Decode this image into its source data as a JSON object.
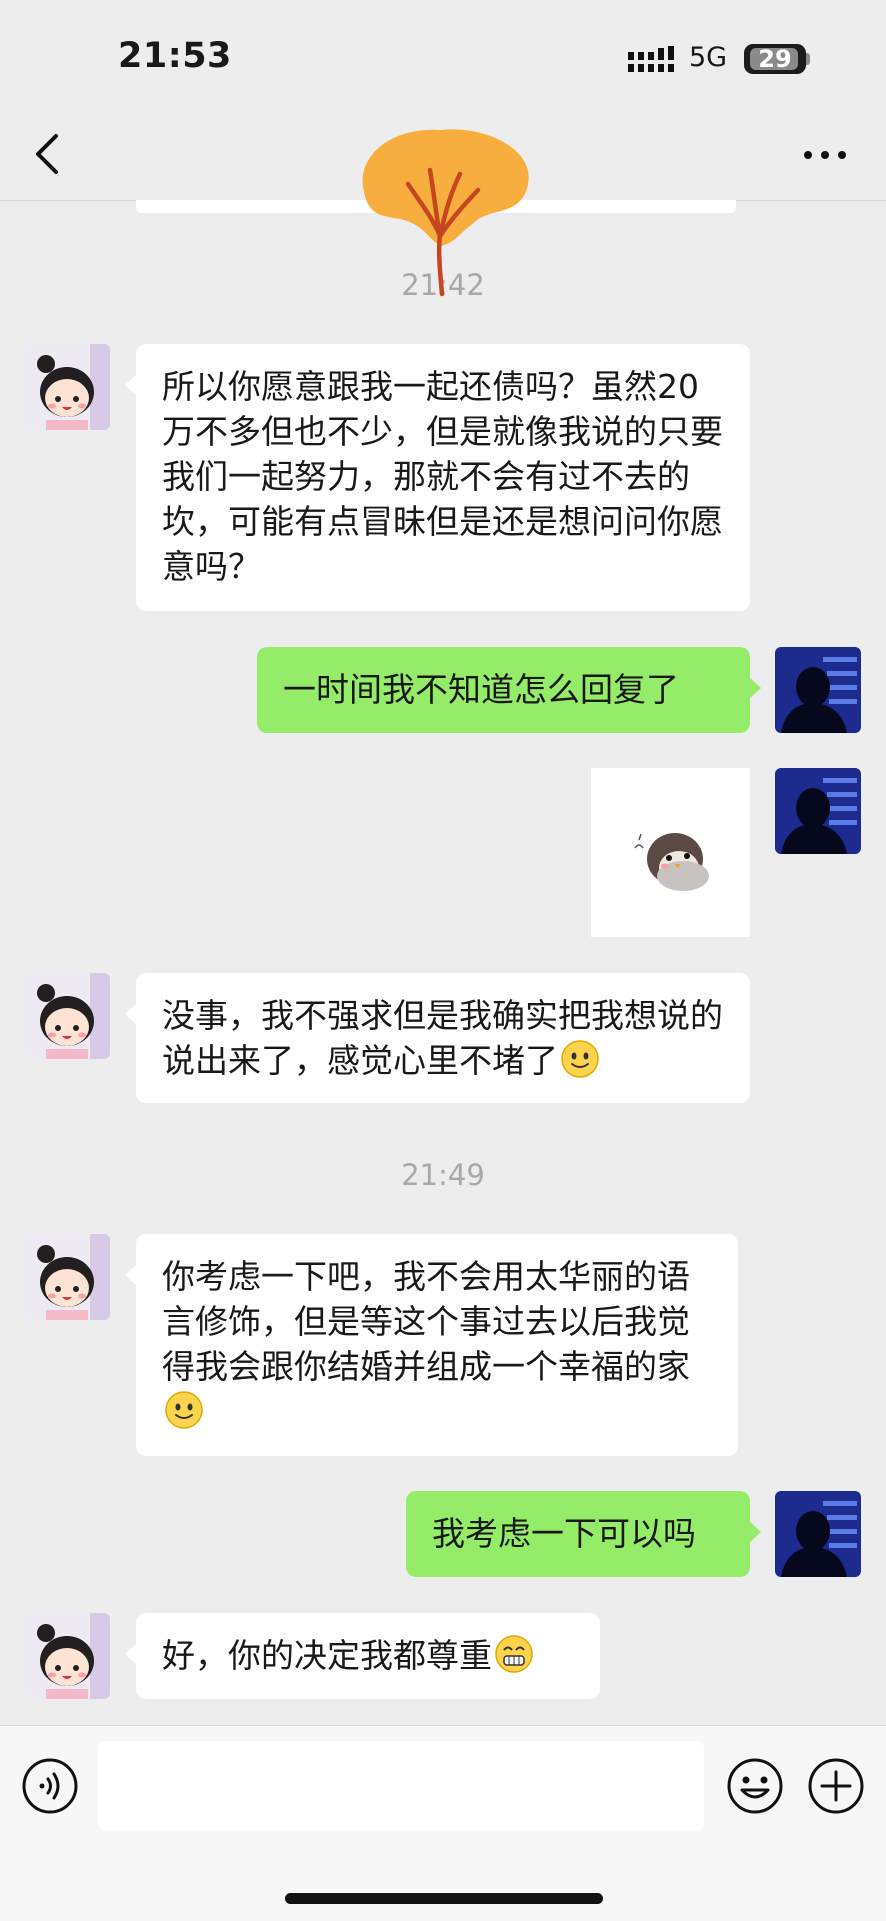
{
  "status_bar": {
    "time": "21:53",
    "network": "5G",
    "battery": "29"
  },
  "header": {
    "title": ""
  },
  "timestamps": [
    "21:42",
    "21:49"
  ],
  "messages": [
    {
      "direction": "in",
      "type": "text",
      "text": "所以你愿意跟我一起还债吗？虽然20万不多但也不少，但是就像我说的只要我们一起努力，那就不会有过不去的坎，可能有点冒昧但是还是想问问你愿意吗？"
    },
    {
      "direction": "out",
      "type": "text",
      "text": "一时间我不知道怎么回复了"
    },
    {
      "direction": "out",
      "type": "sticker",
      "sticker": "penguin-sticker"
    },
    {
      "direction": "in",
      "type": "text",
      "text": "没事，我不强求但是我确实把我想说的说出来了，感觉心里不堵了",
      "emoji": "smile-emoji"
    },
    {
      "direction": "in",
      "type": "text",
      "text": "你考虑一下吧，我不会用太华丽的语言修饰，但是等这个事过去以后我觉得我会跟你结婚并组成一个幸福的家",
      "emoji": "smile-emoji"
    },
    {
      "direction": "out",
      "type": "text",
      "text": "我考虑一下可以吗"
    },
    {
      "direction": "in",
      "type": "text",
      "text": "好，你的决定我都尊重",
      "emoji": "grin-emoji"
    }
  ],
  "colors": {
    "background": "#ededed",
    "outgoing_bubble": "#95ec69",
    "incoming_bubble": "#ffffff"
  },
  "icons": [
    "back-icon",
    "more-icon",
    "voice-icon",
    "emoji-icon",
    "plus-icon"
  ]
}
